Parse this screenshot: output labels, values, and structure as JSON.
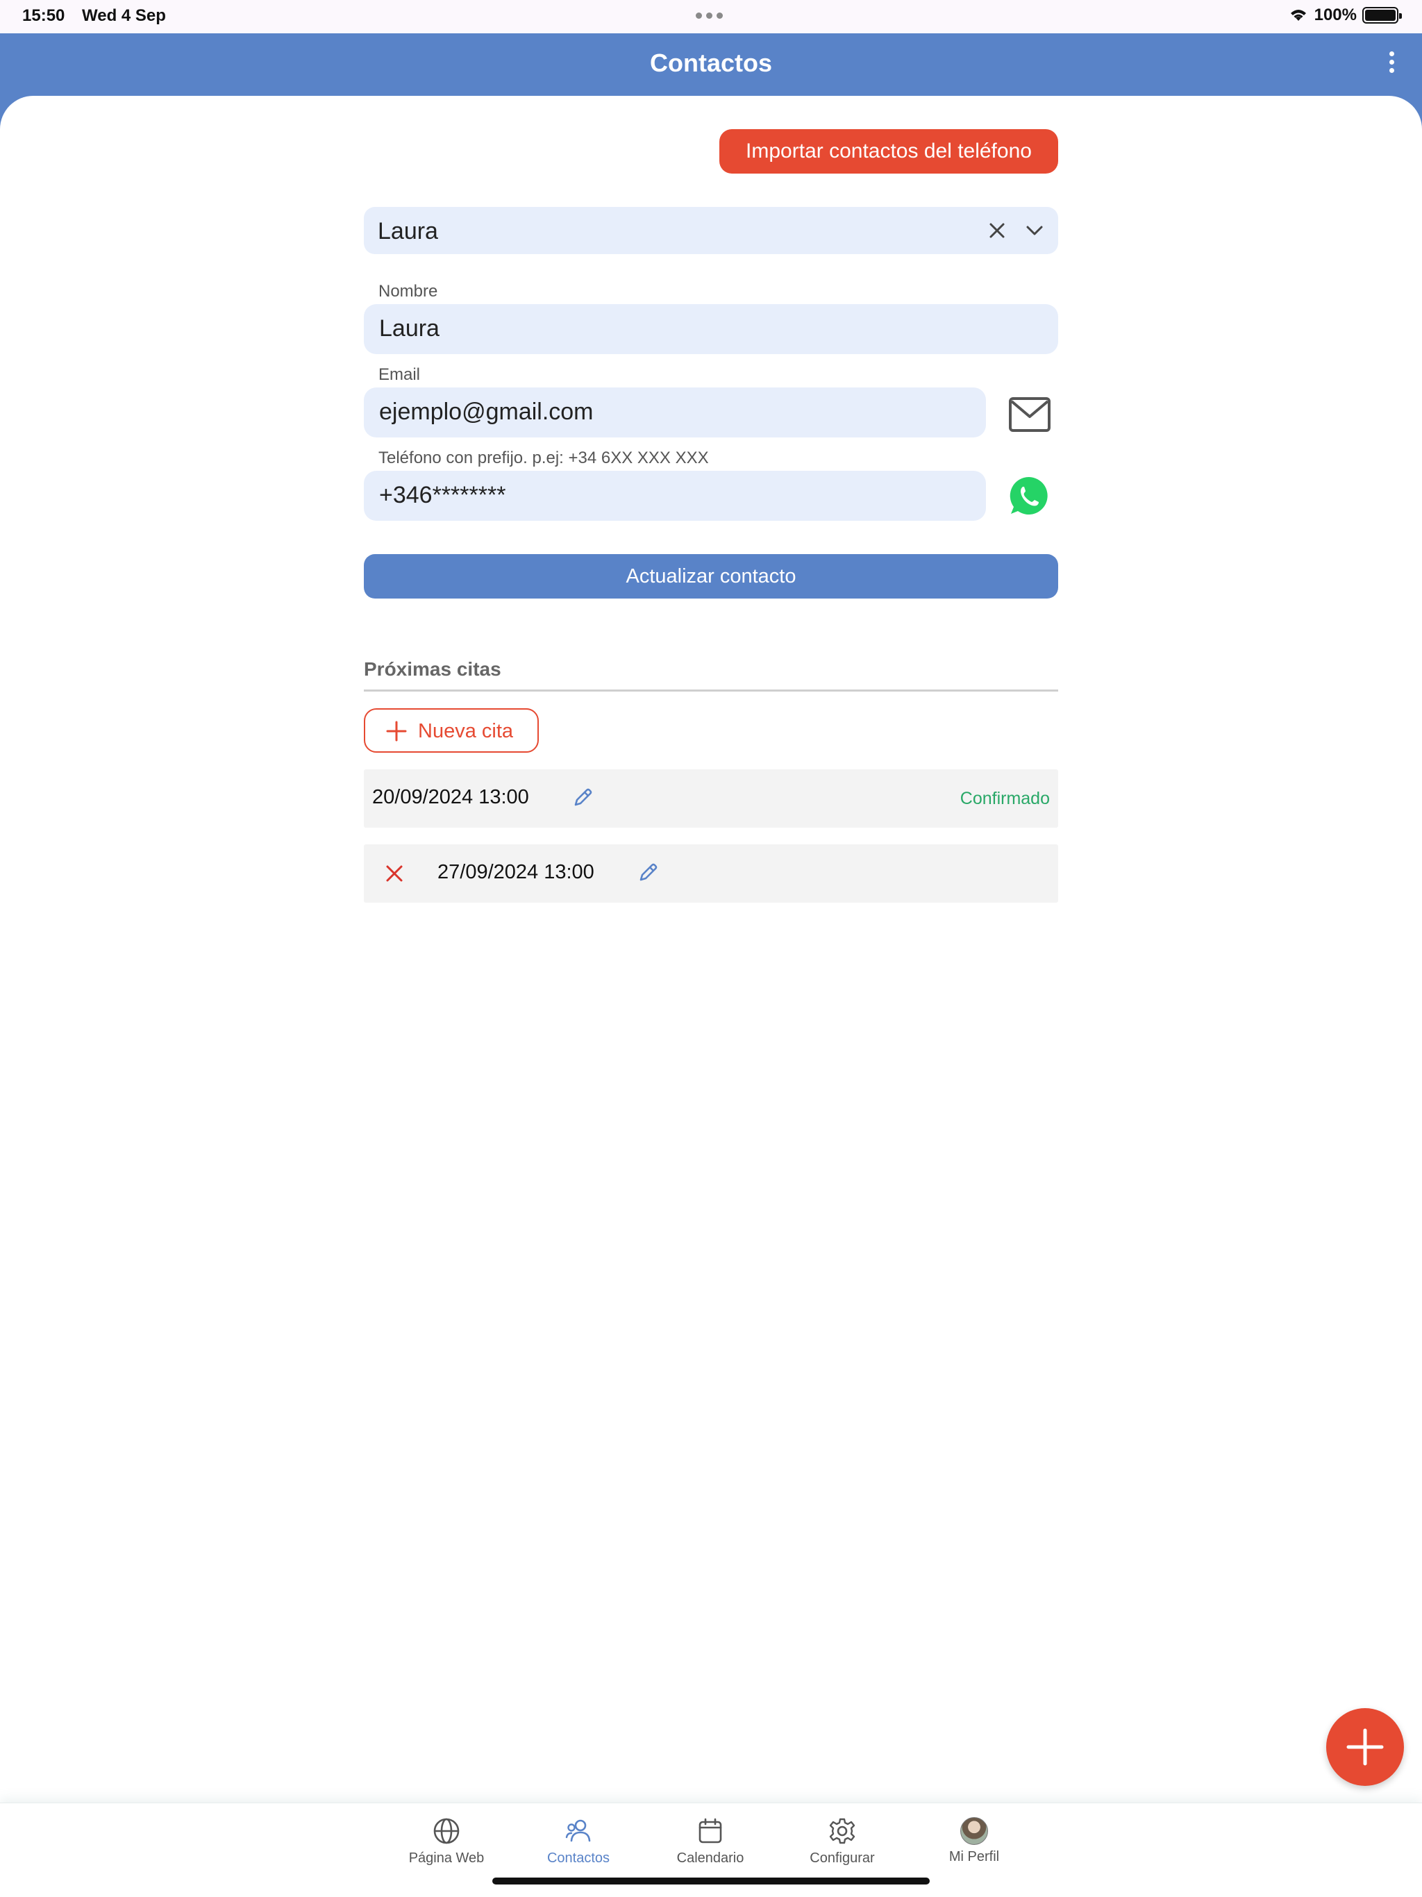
{
  "status_bar": {
    "time": "15:50",
    "date": "Wed 4 Sep",
    "battery": "100%"
  },
  "header": {
    "title": "Contactos"
  },
  "import_button": "Importar contactos del teléfono",
  "contact_selector": {
    "value": "Laura"
  },
  "form": {
    "name_label": "Nombre",
    "name_value": "Laura",
    "email_label": "Email",
    "email_value": "ejemplo@gmail.com",
    "phone_label": "Teléfono con prefijo. p.ej: +34 6XX XXX XXX",
    "phone_value": "+346********",
    "update_button": "Actualizar contacto"
  },
  "appointments": {
    "section_title": "Próximas citas",
    "new_button": "Nueva cita",
    "items": [
      {
        "date": "20/09/2024 13:00",
        "status": "Confirmado"
      },
      {
        "date": "27/09/2024 13:00",
        "status": ""
      }
    ]
  },
  "nav": {
    "items": [
      {
        "label": "Página Web",
        "icon": "globe-icon"
      },
      {
        "label": "Contactos",
        "icon": "contacts-icon",
        "active": true
      },
      {
        "label": "Calendario",
        "icon": "calendar-icon"
      },
      {
        "label": "Configurar",
        "icon": "gear-icon"
      },
      {
        "label": "Mi Perfil",
        "icon": "avatar"
      }
    ]
  },
  "colors": {
    "primary": "#5983c8",
    "accent": "#e64a32",
    "field_bg": "#e7eefb",
    "confirmed": "#29a867",
    "cancel": "#d9342b",
    "whatsapp": "#25d366"
  }
}
